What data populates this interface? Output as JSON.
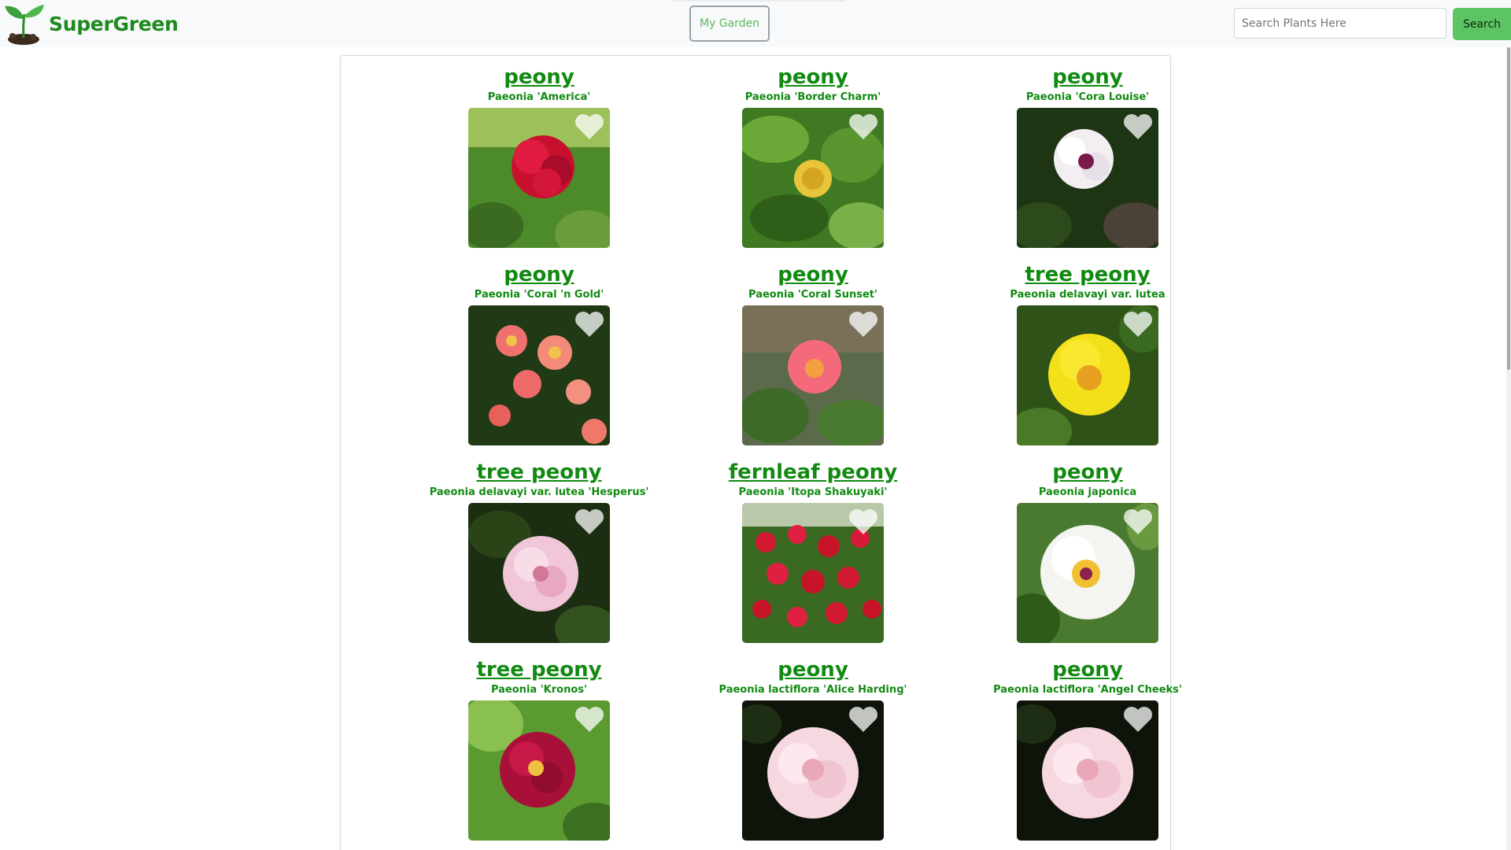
{
  "navbar": {
    "brand": "SuperGreen",
    "garden_button": "My Garden",
    "search_placeholder": "Search Plants Here",
    "search_button": "Search"
  },
  "colors": {
    "brand_green": "#1d8a1d",
    "link_green": "#118a11",
    "search_green": "#5cc463"
  },
  "plants": [
    {
      "common": "peony",
      "scientific": "Paeonia 'America'",
      "flower": "red"
    },
    {
      "common": "peony",
      "scientific": "Paeonia 'Border Charm'",
      "flower": "yellow-small"
    },
    {
      "common": "peony",
      "scientific": "Paeonia 'Cora Louise'",
      "flower": "white-purple"
    },
    {
      "common": "peony",
      "scientific": "Paeonia 'Coral 'n Gold'",
      "flower": "coral-group"
    },
    {
      "common": "peony",
      "scientific": "Paeonia 'Coral Sunset'",
      "flower": "coral-single"
    },
    {
      "common": "tree peony",
      "scientific": "Paeonia delavayi var. lutea",
      "flower": "yellow-large"
    },
    {
      "common": "tree peony",
      "scientific": "Paeonia delavayi var. lutea 'Hesperus'",
      "flower": "pink-ruffled"
    },
    {
      "common": "fernleaf peony",
      "scientific": "Paeonia 'Itopa Shakuyaki'",
      "flower": "red-many"
    },
    {
      "common": "peony",
      "scientific": "Paeonia japonica",
      "flower": "white-single"
    },
    {
      "common": "tree peony",
      "scientific": "Paeonia 'Kronos'",
      "flower": "magenta"
    },
    {
      "common": "peony",
      "scientific": "Paeonia lactiflora 'Alice Harding'",
      "flower": "pink-double"
    },
    {
      "common": "peony",
      "scientific": "Paeonia lactiflora 'Angel Cheeks'",
      "flower": "pink-double"
    }
  ]
}
